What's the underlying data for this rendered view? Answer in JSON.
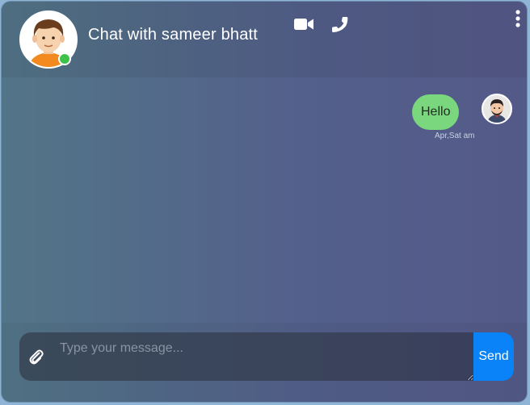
{
  "header": {
    "title": "Chat with sameer bhatt",
    "contact_avatar": "boy-avatar",
    "online_status": "online",
    "icons": [
      "video-camera-icon",
      "phone-icon",
      "more-vertical-icon"
    ]
  },
  "messages": [
    {
      "text": "Hello",
      "time": "Apr,Sat am",
      "sender": "self",
      "avatar": "man-avatar"
    }
  ],
  "composer": {
    "placeholder": "Type your message...",
    "value": "",
    "send_label": "Send",
    "attach_icon": "paperclip-icon"
  },
  "colors": {
    "bubble": "#7ad77e",
    "send_button": "#0a82f8",
    "online_dot": "#3fc24a"
  }
}
